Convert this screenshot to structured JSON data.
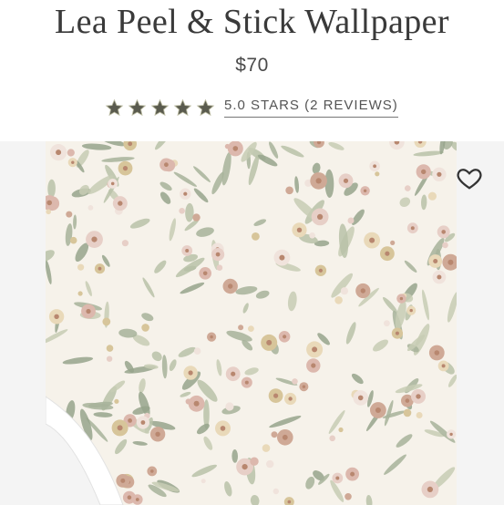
{
  "product": {
    "title": "Lea Peel & Stick Wallpaper",
    "price": "$70",
    "rating": 5.0,
    "rating_max": 5,
    "reviews_link": "5.0 STARS (2 REVIEWS)"
  },
  "icons": {
    "star": "star-icon",
    "wishlist": "heart-icon"
  },
  "colors": {
    "star_fill": "#5a5b4e",
    "text": "#3a3a3a",
    "gallery_bg": "#f4f4f4"
  }
}
